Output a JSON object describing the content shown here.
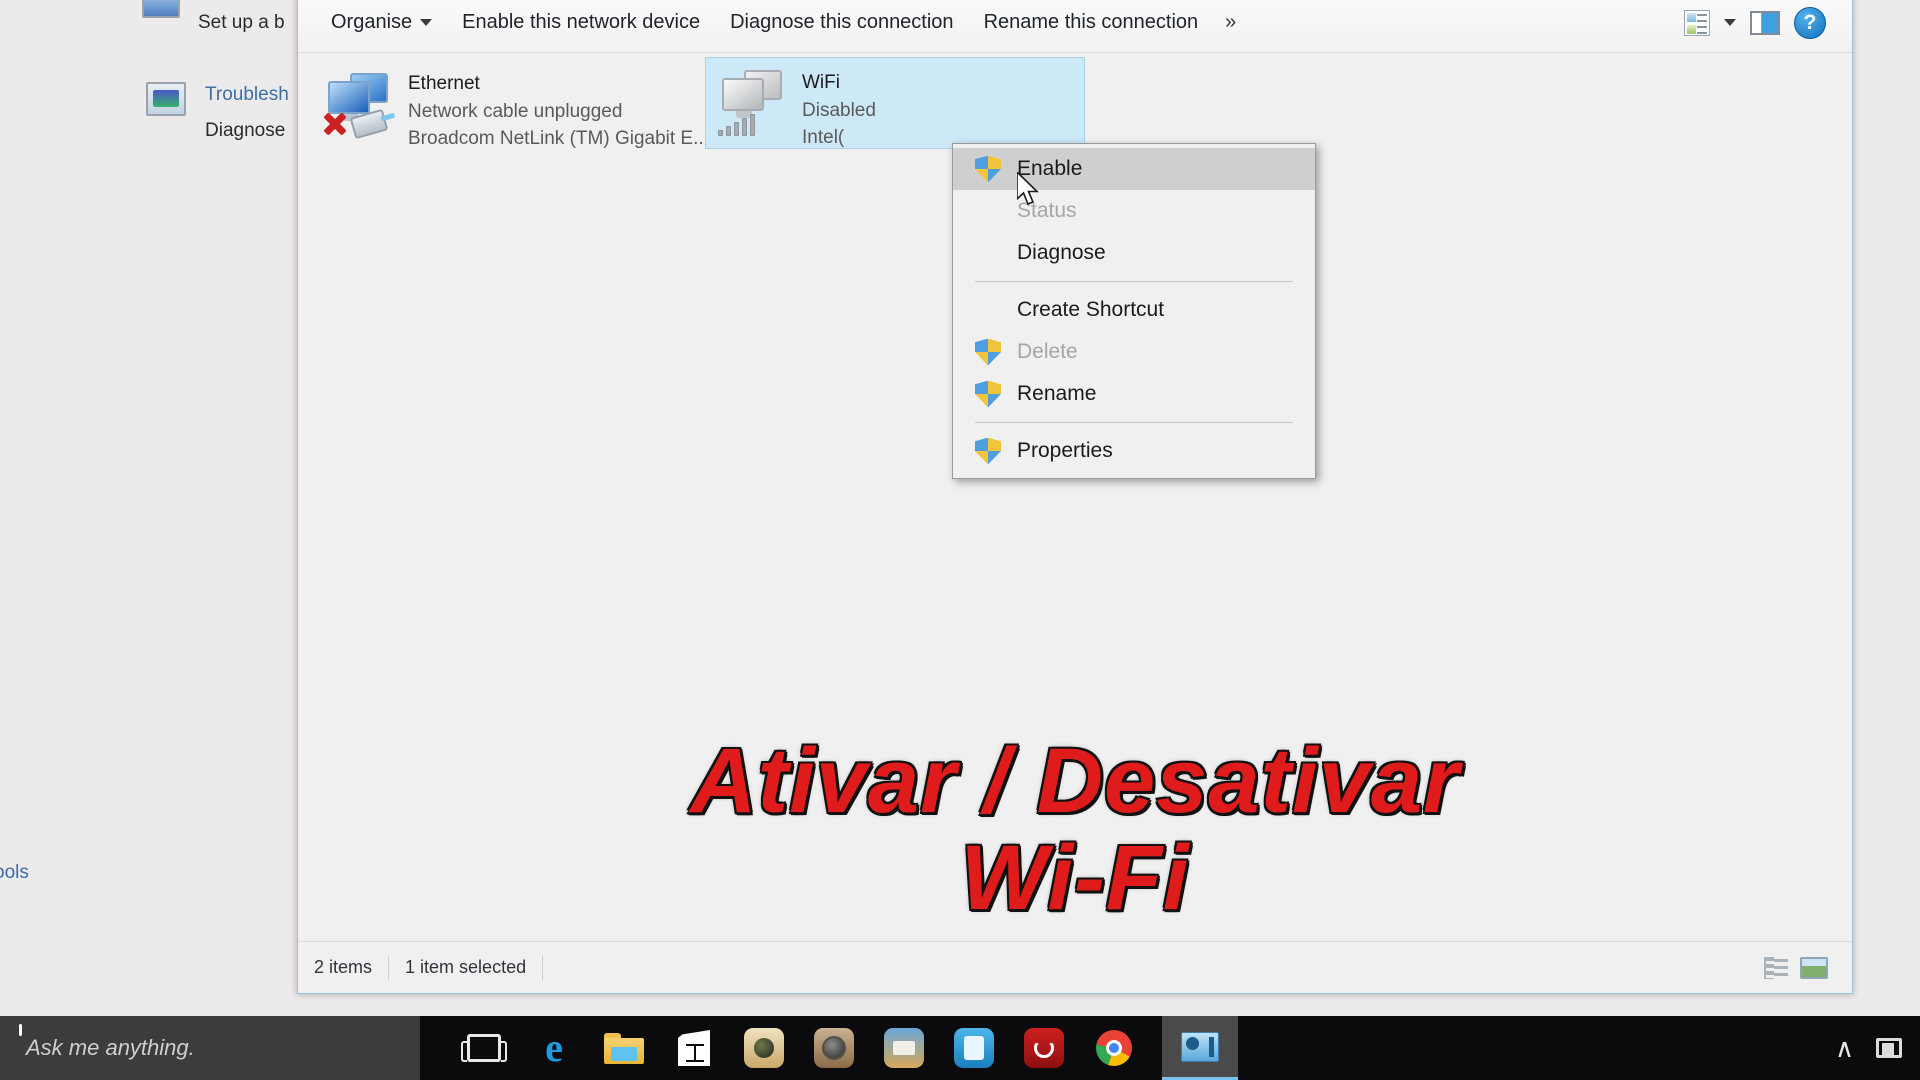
{
  "background_window": {
    "items": [
      {
        "label": "Set up a b",
        "type": "static"
      },
      {
        "label": "Troublesh",
        "type": "link"
      },
      {
        "label": "Diagnose",
        "type": "static"
      },
      {
        "label": "ools",
        "type": "link"
      }
    ]
  },
  "explorer": {
    "toolbar": {
      "organise_label": "Organise",
      "enable_device_label": "Enable this network device",
      "diagnose_label": "Diagnose this connection",
      "rename_label": "Rename this connection",
      "overflow_label": "»",
      "view_options_icon": "view-options-icon",
      "view_dropdown_icon": "chevron-down-icon",
      "preview_pane_icon": "preview-pane-icon",
      "help_icon": "help-icon",
      "help_label": "?"
    },
    "connections": [
      {
        "name": "Ethernet",
        "status": "Network cable unplugged",
        "adapter": "Broadcom NetLink (TM) Gigabit E...",
        "selected": false,
        "icon": "ethernet-unplugged-icon"
      },
      {
        "name": "WiFi",
        "status": "Disabled",
        "adapter": "Intel(",
        "selected": true,
        "icon": "wireless-disabled-icon"
      }
    ],
    "status_bar": {
      "item_count": "2 items",
      "selection": "1 item selected",
      "details_view_icon": "details-view-icon",
      "large_icons_view_icon": "large-icons-view-icon"
    }
  },
  "context_menu": {
    "items": [
      {
        "label": "Enable",
        "shield": true,
        "disabled": false,
        "highlight": true
      },
      {
        "label": "Status",
        "shield": false,
        "disabled": true,
        "highlight": false
      },
      {
        "label": "Diagnose",
        "shield": false,
        "disabled": false,
        "highlight": false
      },
      {
        "separator": true
      },
      {
        "label": "Create Shortcut",
        "shield": false,
        "disabled": false,
        "highlight": false
      },
      {
        "label": "Delete",
        "shield": true,
        "disabled": true,
        "highlight": false
      },
      {
        "label": "Rename",
        "shield": true,
        "disabled": false,
        "highlight": false
      },
      {
        "separator": true
      },
      {
        "label": "Properties",
        "shield": true,
        "disabled": false,
        "highlight": false
      }
    ]
  },
  "caption": {
    "line1": "Ativar / Desativar",
    "line2": "Wi-Fi",
    "color": "#e01b1b"
  },
  "taskbar": {
    "search_placeholder": "Ask me anything.",
    "icons": [
      {
        "name": "task-view-icon"
      },
      {
        "name": "microsoft-edge-icon"
      },
      {
        "name": "file-explorer-icon"
      },
      {
        "name": "microsoft-store-icon"
      },
      {
        "name": "camera-app-icon"
      },
      {
        "name": "speaker-app-icon"
      },
      {
        "name": "document-app-icon"
      },
      {
        "name": "settings-app-icon"
      },
      {
        "name": "power-app-icon"
      },
      {
        "name": "google-chrome-icon"
      },
      {
        "name": "network-connections-icon"
      }
    ],
    "tray": {
      "show_hidden_icons": "∧",
      "tray_icon": "tray-icon"
    }
  }
}
